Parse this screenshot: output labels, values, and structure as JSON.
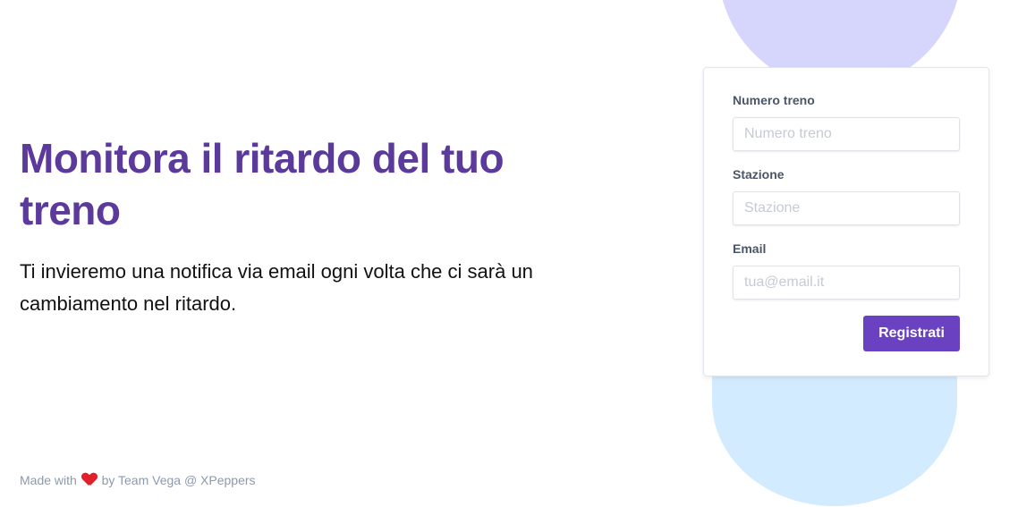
{
  "hero": {
    "title": "Monitora il ritardo del tuo treno",
    "subtitle": "Ti invieremo una notifica via email ogni volta che ci sarà un cambiamento nel ritardo."
  },
  "form": {
    "train_number": {
      "label": "Numero treno",
      "placeholder": "Numero treno",
      "value": ""
    },
    "station": {
      "label": "Stazione",
      "placeholder": "Stazione",
      "value": ""
    },
    "email": {
      "label": "Email",
      "placeholder": "tua@email.it",
      "value": ""
    },
    "submit_label": "Registrati"
  },
  "footer": {
    "made_with": "Made with",
    "heart_icon": "heart-icon",
    "by_team": "by Team Vega @ XPeppers"
  },
  "colors": {
    "title": "#5b3a9c",
    "button": "#6a42c1",
    "blob_top": "#d6d6fd",
    "blob_bottom": "#d3ebfe",
    "heart": "#e0202b"
  }
}
